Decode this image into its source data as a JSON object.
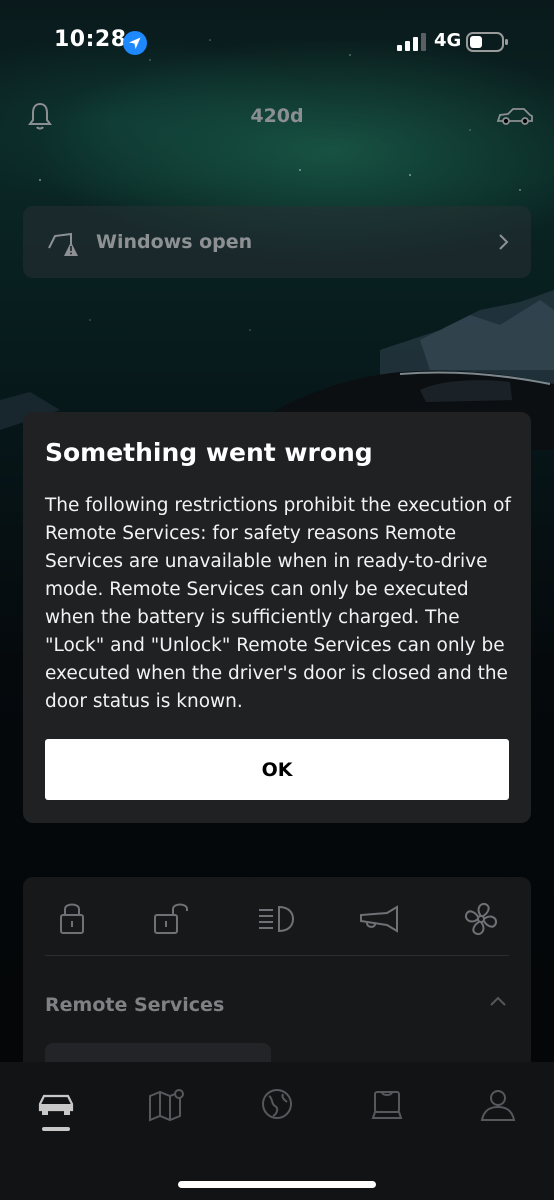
{
  "status_bar": {
    "time": "10:28",
    "network": "4G"
  },
  "header": {
    "vehicle_name": "420d"
  },
  "windows_card": {
    "label": "Windows open"
  },
  "dialog": {
    "title": "Something went wrong",
    "message": "The following restrictions prohibit the execution of Remote Services: for safety reasons Remote Services are unavailable when in ready-to-drive mode. Remote Services can only be executed when the battery is sufficiently charged. The \"Lock\" and \"Unlock\" Remote Services can only be executed when the driver's door is closed and the door status is known.",
    "ok_label": "OK"
  },
  "remote_services": {
    "title": "Remote Services",
    "actions": [
      "lock-icon",
      "unlock-icon",
      "headlight-icon",
      "horn-icon",
      "fan-icon"
    ]
  },
  "tab_bar": {
    "tabs": [
      "car-icon",
      "map-icon",
      "globe-icon",
      "shop-icon",
      "profile-icon"
    ],
    "active": "car-icon"
  },
  "colors": {
    "dialog_background": "#202123",
    "button_background": "#ffffff",
    "muted_text": "#8c8f92"
  }
}
